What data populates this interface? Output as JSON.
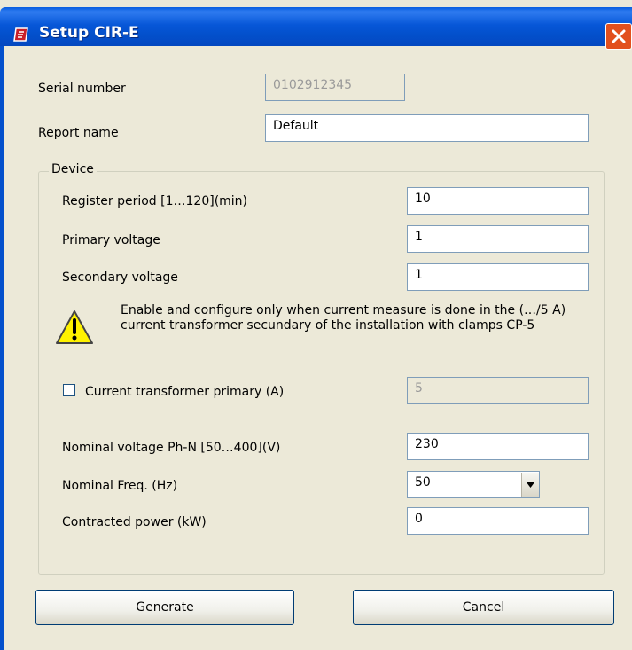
{
  "window": {
    "title": "Setup CIR-E"
  },
  "form": {
    "serial_number": {
      "label": "Serial number",
      "value": "0102912345"
    },
    "report_name": {
      "label": "Report name",
      "value": "Default"
    }
  },
  "device": {
    "legend": "Device",
    "register_period": {
      "label": "Register period [1…120](min)",
      "value": "10"
    },
    "primary_voltage": {
      "label": "Primary voltage",
      "value": "1"
    },
    "secondary_voltage": {
      "label": "Secondary voltage",
      "value": "1"
    },
    "warning_text": "Enable and configure only when current measure is done in the (…/5 A) current transformer secundary of the installation with clamps CP-5",
    "ct_primary": {
      "label": "Current transformer primary (A)",
      "value": "5",
      "checked": false
    },
    "nominal_voltage": {
      "label": "Nominal voltage Ph-N [50…400](V)",
      "value": "230"
    },
    "nominal_freq": {
      "label": "Nominal Freq. (Hz)",
      "value": "50"
    },
    "contracted_power": {
      "label": "Contracted power (kW)",
      "value": "0"
    }
  },
  "buttons": {
    "generate": "Generate",
    "cancel": "Cancel"
  },
  "colors": {
    "titlebar": "#0350CC",
    "close": "#E2501E",
    "window_bg": "#ECE9D8",
    "field_border": "#7F9DB9"
  }
}
